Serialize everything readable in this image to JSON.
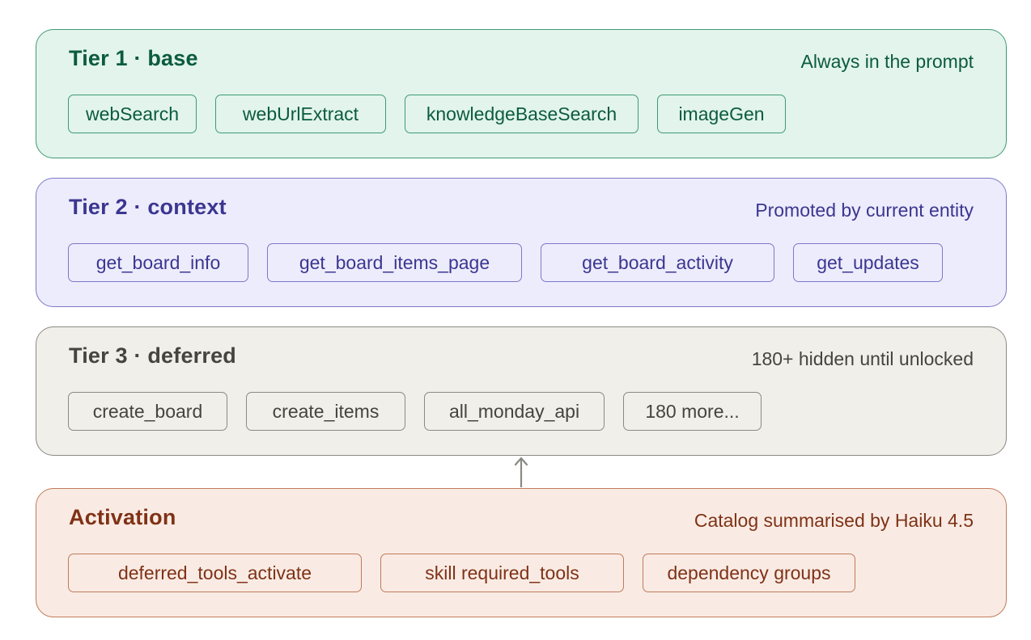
{
  "tiers": [
    {
      "title": "Tier 1 · base",
      "note": "Always in the prompt",
      "chips": [
        "webSearch",
        "webUrlExtract",
        "knowledgeBaseSearch",
        "imageGen"
      ]
    },
    {
      "title": "Tier 2 · context",
      "note": "Promoted by current entity",
      "chips": [
        "get_board_info",
        "get_board_items_page",
        "get_board_activity",
        "get_updates"
      ]
    },
    {
      "title": "Tier 3 · deferred",
      "note": "180+ hidden until unlocked",
      "chips": [
        "create_board",
        "create_items",
        "all_monday_api",
        "180 more..."
      ]
    }
  ],
  "activation": {
    "title": "Activation",
    "note": "Catalog summarised by Haiku 4.5",
    "chips": [
      "deferred_tools_activate",
      "skill required_tools",
      "dependency groups"
    ]
  },
  "colors": {
    "tier1_fill": "#e2f4ec",
    "tier1_stroke": "#3f9a74",
    "tier1_text": "#0c5b3f",
    "tier2_fill": "#ececfc",
    "tier2_stroke": "#7d79c8",
    "tier2_text": "#3c3690",
    "tier3_fill": "#f0efea",
    "tier3_stroke": "#8a8984",
    "tier3_text": "#45443f",
    "activation_fill": "#f9ebe4",
    "activation_stroke": "#c27a59",
    "activation_text": "#7f3216",
    "arrow": "#8a8984"
  }
}
